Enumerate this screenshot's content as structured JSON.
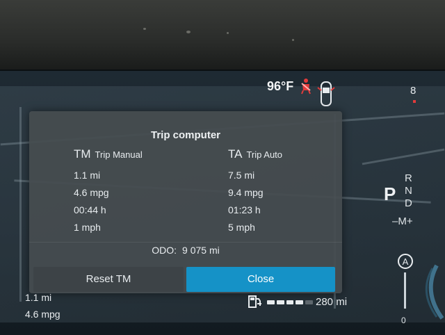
{
  "status": {
    "temperature": "96°F",
    "gear_indicator": "8"
  },
  "dialog": {
    "title": "Trip computer",
    "trip_manual": {
      "abbr": "TM",
      "label": "Trip Manual",
      "distance": "1.1 mi",
      "economy": "4.6 mpg",
      "time": "00:44 h",
      "speed": "1 mph"
    },
    "trip_auto": {
      "abbr": "TA",
      "label": "Trip Auto",
      "distance": "7.5 mi",
      "economy": "9.4 mpg",
      "time": "01:23 h",
      "speed": "5 mph"
    },
    "odo_label": "ODO:",
    "odo_value": "9 075 mi",
    "reset_label": "Reset TM",
    "close_label": "Close"
  },
  "gear_selector": {
    "current": "P",
    "r": "R",
    "n": "N",
    "d": "D",
    "manual": "–M+"
  },
  "bottom_left": {
    "distance": "1.1 mi",
    "economy": "4.6 mpg"
  },
  "range": {
    "value": "280 mi",
    "fuel_level": 0.7
  },
  "gauge": {
    "assist_label": "A",
    "zero_label": "0"
  },
  "colors": {
    "accent": "#1592c7",
    "warning": "#e23b3b"
  },
  "icons": {
    "seatbelt": "seatbelt-warning-icon",
    "car": "car-door-open-icon",
    "fuel": "fuel-pump-icon",
    "assist": "auto-hold-icon"
  }
}
